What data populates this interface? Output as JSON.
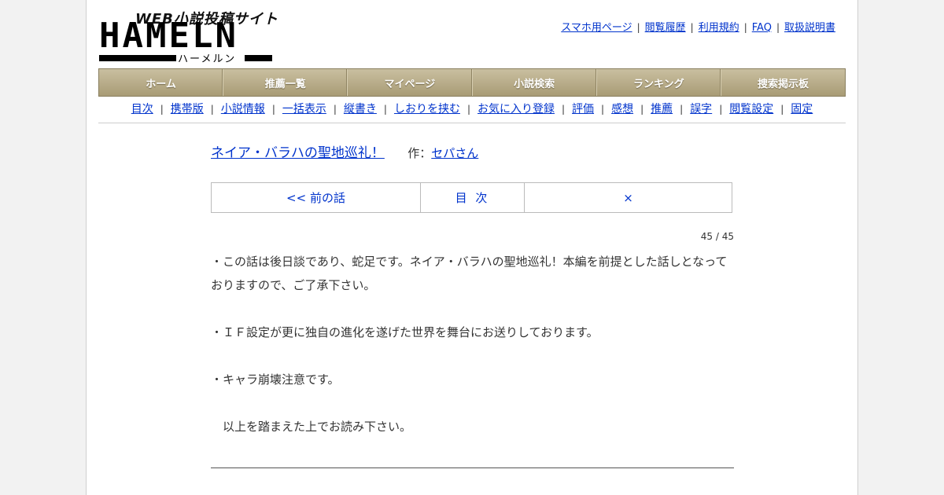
{
  "logo": {
    "tagline": "WEB小説投稿サイト",
    "wordmark": "HAMELN",
    "kana": "ハーメルン"
  },
  "top_links": [
    {
      "label": "スマホ用ページ"
    },
    {
      "label": "閲覧履歴"
    },
    {
      "label": "利用規約"
    },
    {
      "label": "FAQ"
    },
    {
      "label": "取扱説明書"
    }
  ],
  "main_nav": [
    {
      "label": "ホーム"
    },
    {
      "label": "推薦一覧"
    },
    {
      "label": "マイページ"
    },
    {
      "label": "小説検索"
    },
    {
      "label": "ランキング"
    },
    {
      "label": "捜索掲示板"
    }
  ],
  "sub_nav": [
    {
      "label": "目次"
    },
    {
      "label": "携帯版"
    },
    {
      "label": "小説情報"
    },
    {
      "label": "一括表示"
    },
    {
      "label": "縦書き"
    },
    {
      "label": "しおりを挟む"
    },
    {
      "label": "お気に入り登録"
    },
    {
      "label": "評価"
    },
    {
      "label": "感想"
    },
    {
      "label": "推薦"
    },
    {
      "label": "誤字"
    },
    {
      "label": "閲覧設定"
    },
    {
      "label": "固定"
    }
  ],
  "novel": {
    "title": "ネイア・バラハの聖地巡礼！",
    "author_label": "作：",
    "author": "セパさん",
    "pager": {
      "prev": "<< 前の話",
      "toc": "目 次",
      "next": "×"
    },
    "count": "45 / 45",
    "paragraphs": [
      "・この話は後日談であり、蛇足です。ネイア・バラハの聖地巡礼！本編を前提とした話しとなっておりますので、ご了承下さい。",
      "",
      "・ＩＦ設定が更に独自の進化を遂げた世界を舞台にお送りしております。",
      "",
      "・キャラ崩壊注意です。",
      "",
      "　以上を踏まえた上でお読み下さい。"
    ]
  }
}
